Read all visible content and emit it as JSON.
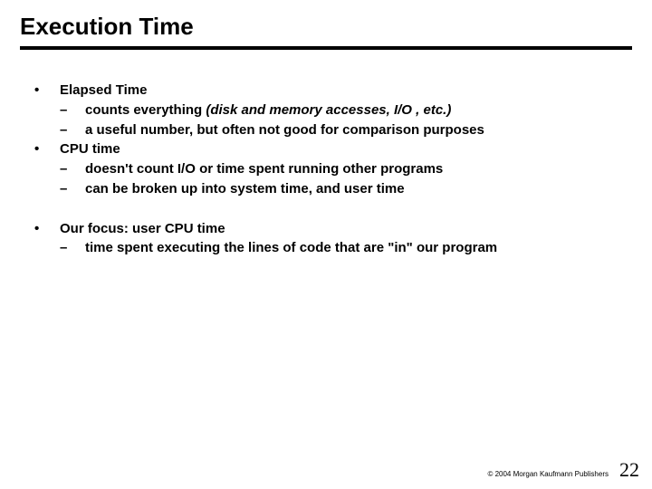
{
  "title": "Execution Time",
  "bullets": {
    "b1": {
      "head": "Elapsed Time",
      "s1_plain": "counts everything  ",
      "s1_italic": "(disk and memory accesses, I/O , etc.)",
      "s2": "a useful number, but often not good for comparison purposes"
    },
    "b2": {
      "head": "CPU time",
      "s1": "doesn't count I/O or time spent running other programs",
      "s2": "can be broken up into system time, and user time"
    },
    "b3": {
      "head": "Our focus:  user CPU time",
      "s1": "time spent executing the lines of code that are \"in\" our program"
    }
  },
  "footer": {
    "copyright": "© 2004 Morgan Kaufmann Publishers",
    "page": "22"
  },
  "glyphs": {
    "bullet": "•",
    "dash": "–"
  }
}
